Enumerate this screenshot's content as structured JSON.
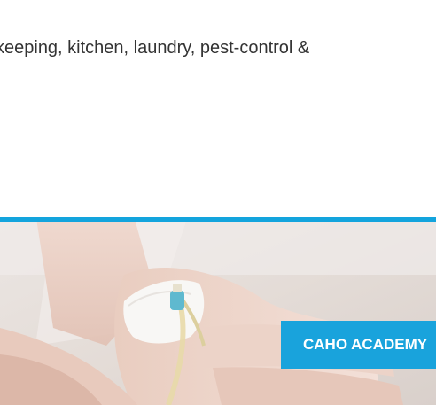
{
  "content": {
    "paragraph_line": "keeping, kitchen, laundry, pest-control &"
  },
  "hero": {
    "image_icon": "iv-drip-on-hand-photo",
    "button_label": "CAHO ACADEMY"
  },
  "colors": {
    "accent": "#13a4dd",
    "button_bg": "#19a3dc",
    "text": "#333333"
  }
}
